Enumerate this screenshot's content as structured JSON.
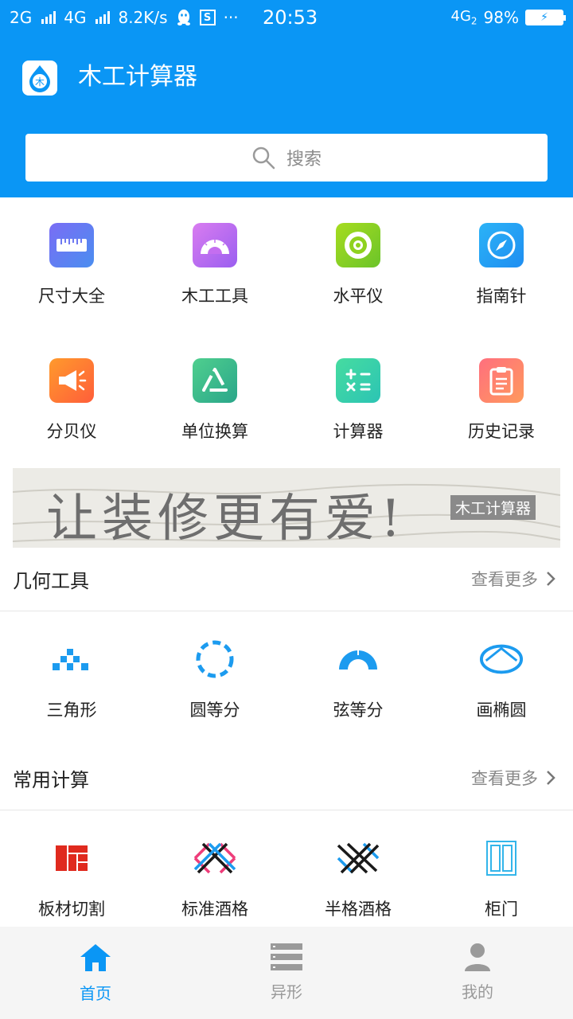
{
  "status_bar": {
    "network1": "2G",
    "network2": "4G",
    "speed": "8.2K/s",
    "sim_badge": "S",
    "more": "···",
    "time": "20:53",
    "network3": "4G",
    "network3_sub": "2",
    "battery_percent": "98%",
    "battery_glyph": "⚡"
  },
  "app": {
    "title": "木工计算器",
    "logo_icon": "wood-drop-logo",
    "logo_char": "木"
  },
  "search": {
    "label": "搜索",
    "icon": "search-icon"
  },
  "tools": [
    {
      "label": "尺寸大全",
      "icon": "ruler-icon",
      "color": "#6d78f2"
    },
    {
      "label": "木工工具",
      "icon": "protractor-icon",
      "color": "#c46ef0"
    },
    {
      "label": "水平仪",
      "icon": "level-icon",
      "color": "#8fd21e"
    },
    {
      "label": "指南针",
      "icon": "compass-icon",
      "color": "#28a8f6"
    },
    {
      "label": "分贝仪",
      "icon": "megaphone-icon",
      "color": "#ff8a2c"
    },
    {
      "label": "单位换算",
      "icon": "recycle-icon",
      "color": "#3ebd8c"
    },
    {
      "label": "计算器",
      "icon": "calculator-icon",
      "color": "#3fd3a6"
    },
    {
      "label": "历史记录",
      "icon": "clipboard-icon",
      "color": "#ff6a7a"
    }
  ],
  "banner": {
    "slogan": "让装修更有爱!",
    "tag": "木工计算器"
  },
  "geometry_section": {
    "title": "几何工具",
    "more": "查看更多",
    "items": [
      {
        "label": "三角形",
        "icon": "triangle-blocks-icon"
      },
      {
        "label": "圆等分",
        "icon": "dashed-circle-icon"
      },
      {
        "label": "弦等分",
        "icon": "semicircle-icon"
      },
      {
        "label": "画椭圆",
        "icon": "ellipse-icon"
      }
    ]
  },
  "common_section": {
    "title": "常用计算",
    "more": "查看更多",
    "items": [
      {
        "label": "板材切割",
        "icon": "board-cut-icon"
      },
      {
        "label": "标准酒格",
        "icon": "wine-rack-icon"
      },
      {
        "label": "半格酒格",
        "icon": "half-wine-rack-icon"
      },
      {
        "label": "柜门",
        "icon": "cabinet-door-icon"
      }
    ]
  },
  "tabbar": [
    {
      "label": "首页",
      "icon": "home-icon",
      "active": true
    },
    {
      "label": "异形",
      "icon": "list-icon",
      "active": false
    },
    {
      "label": "我的",
      "icon": "user-icon",
      "active": false
    }
  ],
  "colors": {
    "primary": "#0a96f5",
    "geometry_icon": "#1c9bef",
    "board_cut": "#e02a1e",
    "tab_inactive": "#999999"
  }
}
